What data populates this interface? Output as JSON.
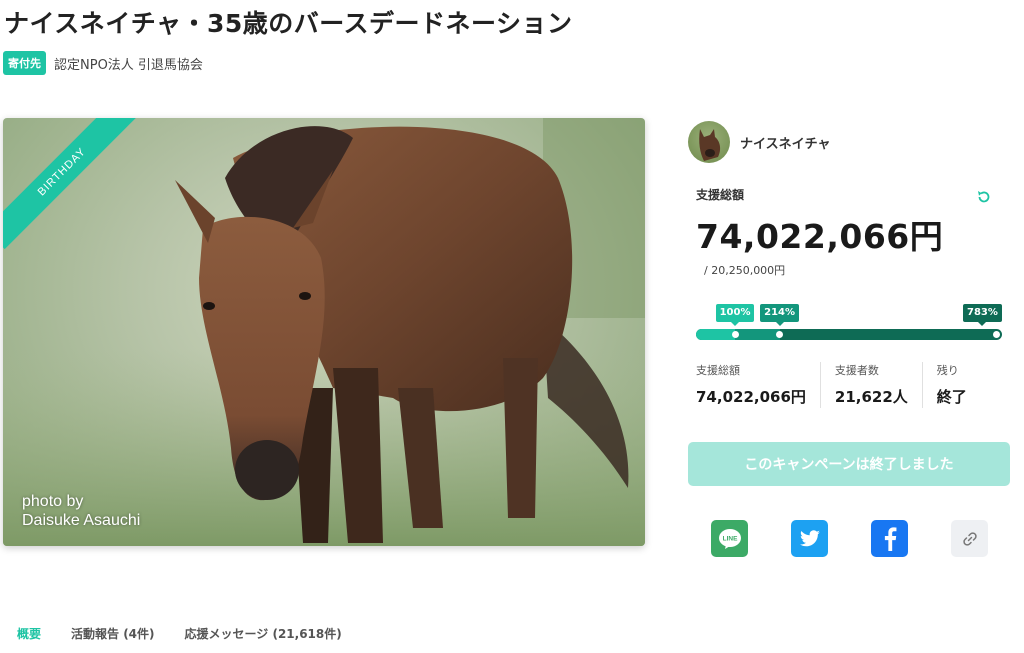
{
  "page": {
    "title": "ナイスネイチャ・35歳のバースデードネーション",
    "org_badge": "寄付先",
    "org_name": "認定NPO法人 引退馬協会"
  },
  "hero": {
    "ribbon": "BIRTHDAY",
    "credit_line1": "photo by",
    "credit_line2": "Daisuke Asauchi"
  },
  "owner": {
    "name": "ナイスネイチャ"
  },
  "funding": {
    "total_label": "支援総額",
    "total_amount": "74,022,066円",
    "goal": "/ 20,250,000円",
    "progress_percent": 783,
    "milestones": [
      {
        "label": "100%",
        "percent": 100
      },
      {
        "label": "214%",
        "percent": 214
      },
      {
        "label": "783%",
        "percent": 783
      }
    ]
  },
  "stats": [
    {
      "label": "支援総額",
      "value": "74,022,066円"
    },
    {
      "label": "支援者数",
      "value": "21,622人"
    },
    {
      "label": "残り",
      "value": "終了"
    }
  ],
  "cta": {
    "label": "このキャンペーンは終了しました"
  },
  "share": {
    "line_label": "LINE",
    "icons": [
      "line-icon",
      "twitter-icon",
      "facebook-icon",
      "link-icon"
    ]
  },
  "tabs": [
    {
      "label": "概要",
      "active": true
    },
    {
      "label": "活動報告 (4件)",
      "active": false
    },
    {
      "label": "応援メッセージ (21,618件)",
      "active": false
    }
  ],
  "colors": {
    "accent": "#1ec4a4",
    "accent_mid": "#13967c",
    "accent_dark": "#0e6b55",
    "cta_disabled": "#a5e6da"
  }
}
